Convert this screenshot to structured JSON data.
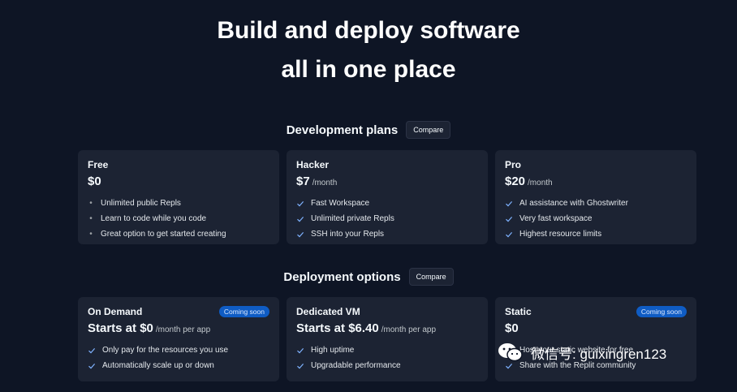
{
  "hero": {
    "line1": "Build and deploy software",
    "line2": "all in one place"
  },
  "development": {
    "title": "Development plans",
    "compare_label": "Compare",
    "plans": [
      {
        "name": "Free",
        "price": "$0",
        "suffix": "",
        "icon": "bullet-icon",
        "features": [
          "Unlimited public Repls",
          "Learn to code while you code",
          "Great option to get started creating"
        ]
      },
      {
        "name": "Hacker",
        "price": "$7",
        "suffix": "/month",
        "icon": "check-icon",
        "features": [
          "Fast Workspace",
          "Unlimited private Repls",
          "SSH into your Repls"
        ]
      },
      {
        "name": "Pro",
        "price": "$20",
        "suffix": "/month",
        "icon": "check-icon",
        "features": [
          "AI assistance with Ghostwriter",
          "Very fast workspace",
          "Highest resource limits"
        ]
      }
    ]
  },
  "deployment": {
    "title": "Deployment options",
    "compare_label": "Compare",
    "options": [
      {
        "name": "On Demand",
        "badge": "Coming soon",
        "price": "Starts at $0",
        "suffix": "/month per app",
        "features": [
          "Only pay for the resources you use",
          "Automatically scale up or down"
        ]
      },
      {
        "name": "Dedicated VM",
        "badge": "",
        "price": "Starts at $6.40",
        "suffix": "/month per app",
        "features": [
          "High uptime",
          "Upgradable performance"
        ]
      },
      {
        "name": "Static",
        "badge": "Coming soon",
        "price": "$0",
        "suffix": "",
        "features": [
          "Host your static website for free",
          "Share with the Replit community"
        ]
      }
    ]
  },
  "watermark": {
    "text": "微信号: guixingren123"
  },
  "colors": {
    "background": "#0e1525",
    "card": "#1c2333",
    "badge": "#0f5cc4",
    "check": "#7fb2ff"
  }
}
